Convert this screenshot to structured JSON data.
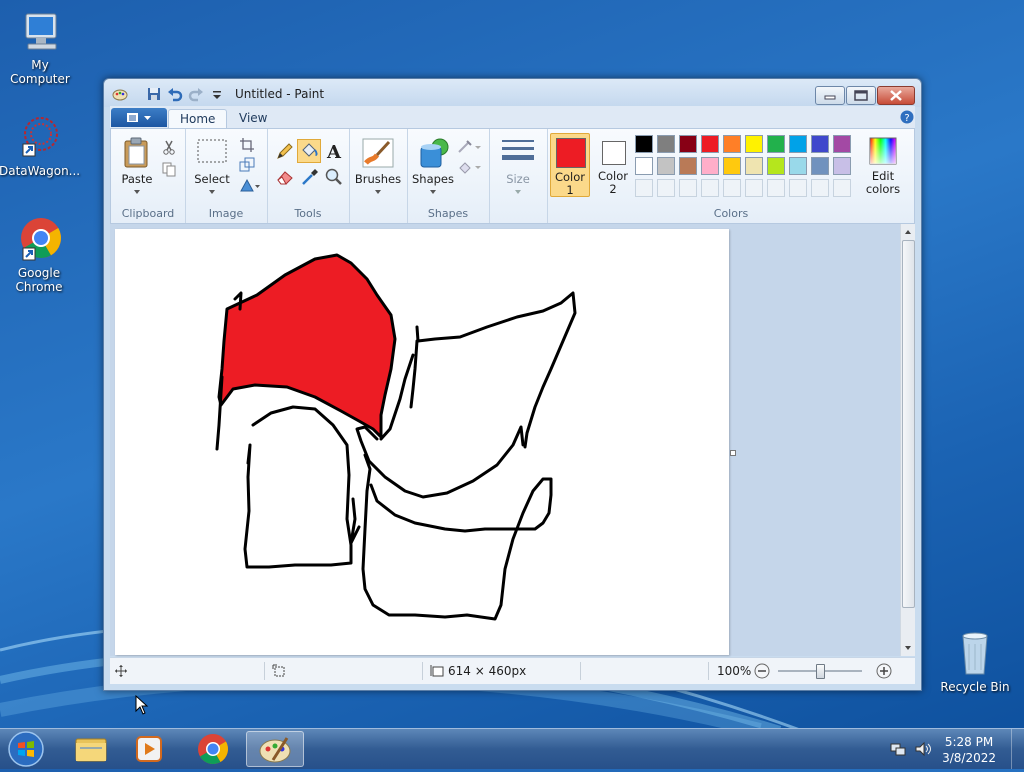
{
  "desktop": {
    "icons": [
      {
        "label": "My Computer"
      },
      {
        "label": "DataWagon..."
      },
      {
        "label": "Google Chrome"
      },
      {
        "label": "Recycle Bin"
      }
    ]
  },
  "window": {
    "title": "Untitled - Paint",
    "tabs": [
      "Home",
      "View"
    ]
  },
  "ribbon": {
    "clipboard": {
      "paste": "Paste",
      "label": "Clipboard"
    },
    "image": {
      "select": "Select",
      "label": "Image"
    },
    "tools": {
      "label": "Tools"
    },
    "brushes": {
      "label": "Brushes"
    },
    "shapes": {
      "button": "Shapes",
      "label": "Shapes"
    },
    "size": {
      "label": "Size"
    },
    "color1": {
      "line1": "Color",
      "line2": "1",
      "value": "#ed1c24"
    },
    "color2": {
      "line1": "Color",
      "line2": "2",
      "value": "#ffffff"
    },
    "colors": {
      "label": "Colors",
      "edit_line1": "Edit",
      "edit_line2": "colors"
    }
  },
  "palette": {
    "row1": [
      "#000000",
      "#7f7f7f",
      "#880015",
      "#ed1c24",
      "#ff7f27",
      "#fff200",
      "#22b14c",
      "#00a2e8",
      "#3f48cc",
      "#a349a4"
    ],
    "row2": [
      "#ffffff",
      "#c3c3c3",
      "#b97a57",
      "#ffaec9",
      "#ffc90e",
      "#efe4b0",
      "#b5e61d",
      "#99d9ea",
      "#7092be",
      "#c8bfe7"
    ]
  },
  "status": {
    "canvas_size": "614 × 460px",
    "zoom": "100%"
  },
  "taskbar": {
    "time": "5:28 PM",
    "date": "3/8/2022"
  }
}
